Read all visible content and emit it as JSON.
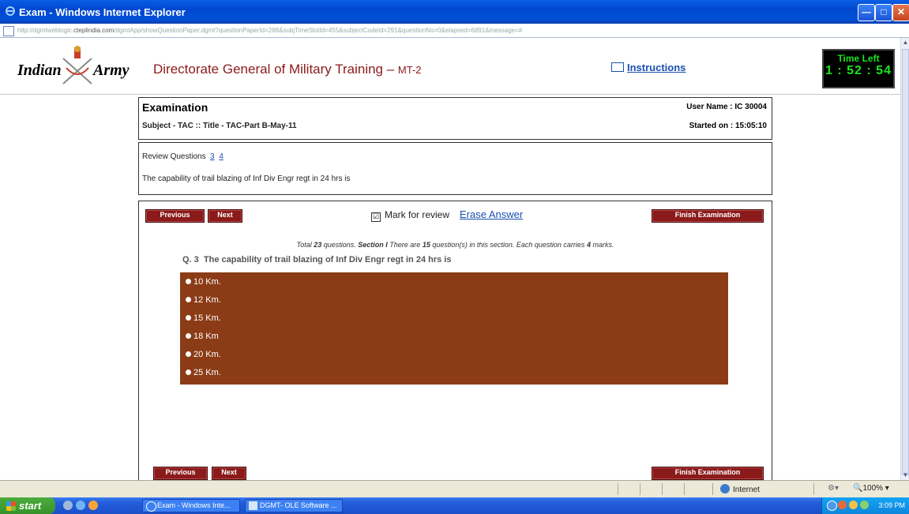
{
  "window": {
    "title": "Exam - Windows Internet Explorer",
    "address_prefix": "http://dgmtweblogic.",
    "address_host": "cteplindia.com",
    "address_path": "/dgmtApp/showQuestionPaper.dgmt?questionPaperId=288&subjTimeSlotId=455&subjectCodeId=291&questionNo=0&elapsed=6891&message=#"
  },
  "header": {
    "logo_word1": "Indian",
    "logo_word2": "Army",
    "org_name": "Directorate General of Military Training –",
    "org_suffix": "MT-2",
    "instructions": "Instructions",
    "time_left_label": "Time Left",
    "time_left_value": "1 : 52 : 54"
  },
  "exam": {
    "heading": "Examination",
    "subject": "Subject - TAC :: Title - TAC-Part B-May-11",
    "user": "User Name : IC 30004",
    "started": "Started on : 15:05:10"
  },
  "review": {
    "label": "Review Questions",
    "links": [
      "3",
      "4"
    ],
    "question": "The capability of trail blazing of Inf Div Engr regt in 24 hrs is"
  },
  "controls": {
    "previous": "Previous",
    "next": "Next",
    "mark_check": "☑",
    "mark_label": "Mark for review",
    "erase": "Erase Answer",
    "finish": "Finish Examination"
  },
  "info": {
    "p1": "Total ",
    "total": "23",
    "p2": " questions. ",
    "section": "Section I",
    "p3": " There are ",
    "count": "15",
    "p4": " question(s) in this section. Each question carries ",
    "marks": "4",
    "p5": " marks."
  },
  "question": {
    "number": "Q. 3",
    "text": "The capability of trail blazing of Inf Div Engr regt in 24 hrs is",
    "options": [
      "10 Km.",
      "12 Km.",
      "15 Km.",
      "18 Km",
      "20 Km.",
      "25 Km."
    ]
  },
  "statusbar": {
    "zone": "Internet",
    "zoom": "100%"
  },
  "taskbar": {
    "start": "start",
    "task1": "Exam - Windows Inte...",
    "task2": "DGMT- OLE Software ...",
    "clock": "3:09 PM"
  }
}
